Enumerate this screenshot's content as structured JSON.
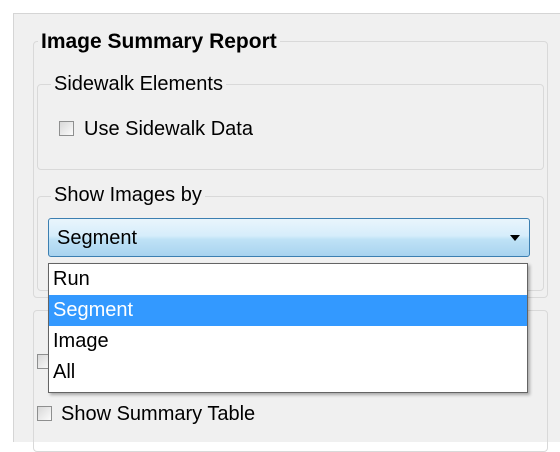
{
  "report": {
    "title": "Image Summary Report",
    "sidewalk": {
      "title": "Sidewalk Elements",
      "checkbox_label": "Use Sidewalk Data",
      "checked": false
    },
    "show_images": {
      "title": "Show Images by",
      "selected_value": "Segment",
      "options": [
        "Run",
        "Segment",
        "Image",
        "All"
      ]
    }
  },
  "summary": {
    "checkbox_label": "Show Summary Table",
    "checked": false
  }
}
